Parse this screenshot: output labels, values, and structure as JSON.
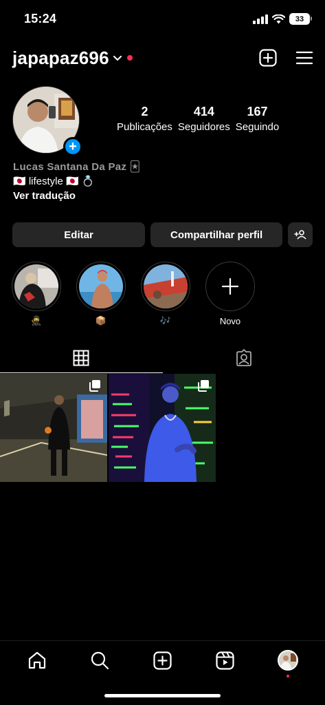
{
  "status": {
    "time": "15:24",
    "battery": "33"
  },
  "header": {
    "username": "japapaz696"
  },
  "profile": {
    "stats": [
      {
        "value": "2",
        "label": "Publicações"
      },
      {
        "value": "414",
        "label": "Seguidores"
      },
      {
        "value": "167",
        "label": "Seguindo"
      }
    ],
    "bio_name": "Lucas Santana Da Paz 🃏",
    "bio_line": "🇯🇵 lifestyle 🇯🇵 💍",
    "translate": "Ver tradução"
  },
  "buttons": {
    "edit": "Editar",
    "share": "Compartilhar perfil"
  },
  "highlights": [
    {
      "label": "🥷"
    },
    {
      "label": "📦"
    },
    {
      "label": "🎶"
    }
  ],
  "new_highlight": {
    "label": "Novo"
  },
  "colors": {
    "accent": "#0095f6",
    "notification": "#ff2d55",
    "button_bg": "#262626"
  }
}
